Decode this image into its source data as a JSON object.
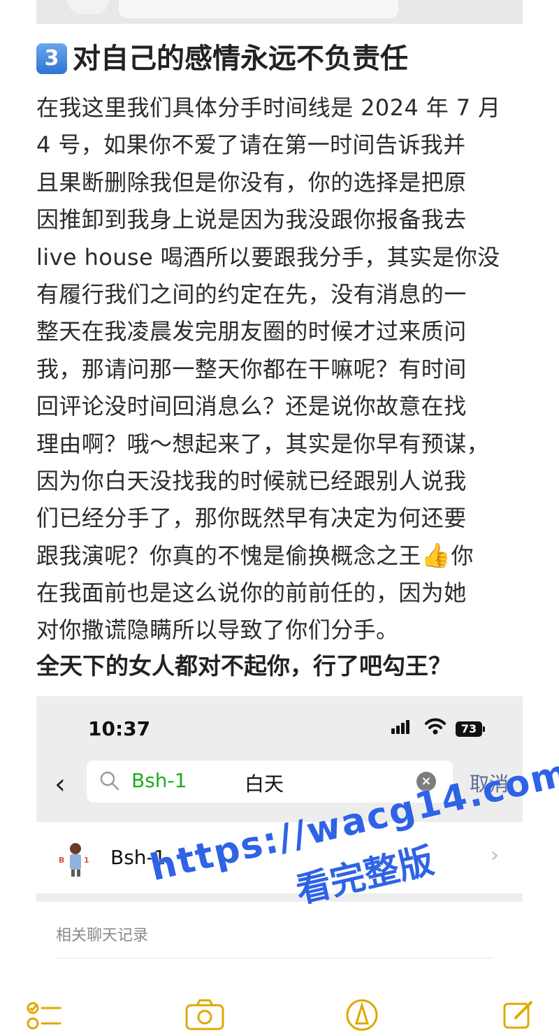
{
  "heading": {
    "badge": "3",
    "title": "对自己的感情永远不负责任"
  },
  "body_lines": [
    "在我这里我们具体分手时间线是 2024 年 7 月",
    "4 号，如果你不爱了请在第一时间告诉我并",
    "且果断删除我但是你没有，你的选择是把原",
    "因推卸到我身上说是因为我没跟你报备我去",
    "live house 喝酒所以要跟我分手，其实是你没",
    "有履行我们之间的约定在先，没有消息的一",
    "整天在我凌晨发完朋友圈的时候才过来质问",
    "我，那请问那一整天你都在干嘛呢？有时间",
    "回评论没时间回消息么？还是说你故意在找",
    "理由啊？哦～想起来了，其实是你早有预谋，",
    "因为你白天没找我的时候就已经跟别人说我",
    "们已经分手了，那你既然早有决定为何还要"
  ],
  "line_13_before": "跟我演呢？你真的不愧是偷换概念之王",
  "line_13_emoji": "👍",
  "line_13_after": "你",
  "body_lines_tail": [
    "在我面前也是这么说你的前前任的，因为她",
    "对你撒谎隐瞒所以导致了你们分手。"
  ],
  "bold_line": "全天下的女人都对不起你，行了吧勾王？",
  "screenshot": {
    "time": "10:37",
    "battery": "73",
    "search_query_highlight": "Bsh-1",
    "search_query_rest": "白天",
    "cancel_label": "取消",
    "contact_name": "Bsh-1",
    "related_label": "相关聊天记录"
  },
  "watermark": {
    "url": "https://wacg14.com",
    "caption": "看完整版"
  },
  "toolbar": {
    "icons": [
      "checklist-icon",
      "camera-icon",
      "markup-icon",
      "compose-icon"
    ]
  },
  "colors": {
    "accent_green": "#1aad19",
    "watermark_blue": "#2f63e6",
    "toolbar_yellow": "#e0a800",
    "cancel_blue": "#5b6b94"
  }
}
